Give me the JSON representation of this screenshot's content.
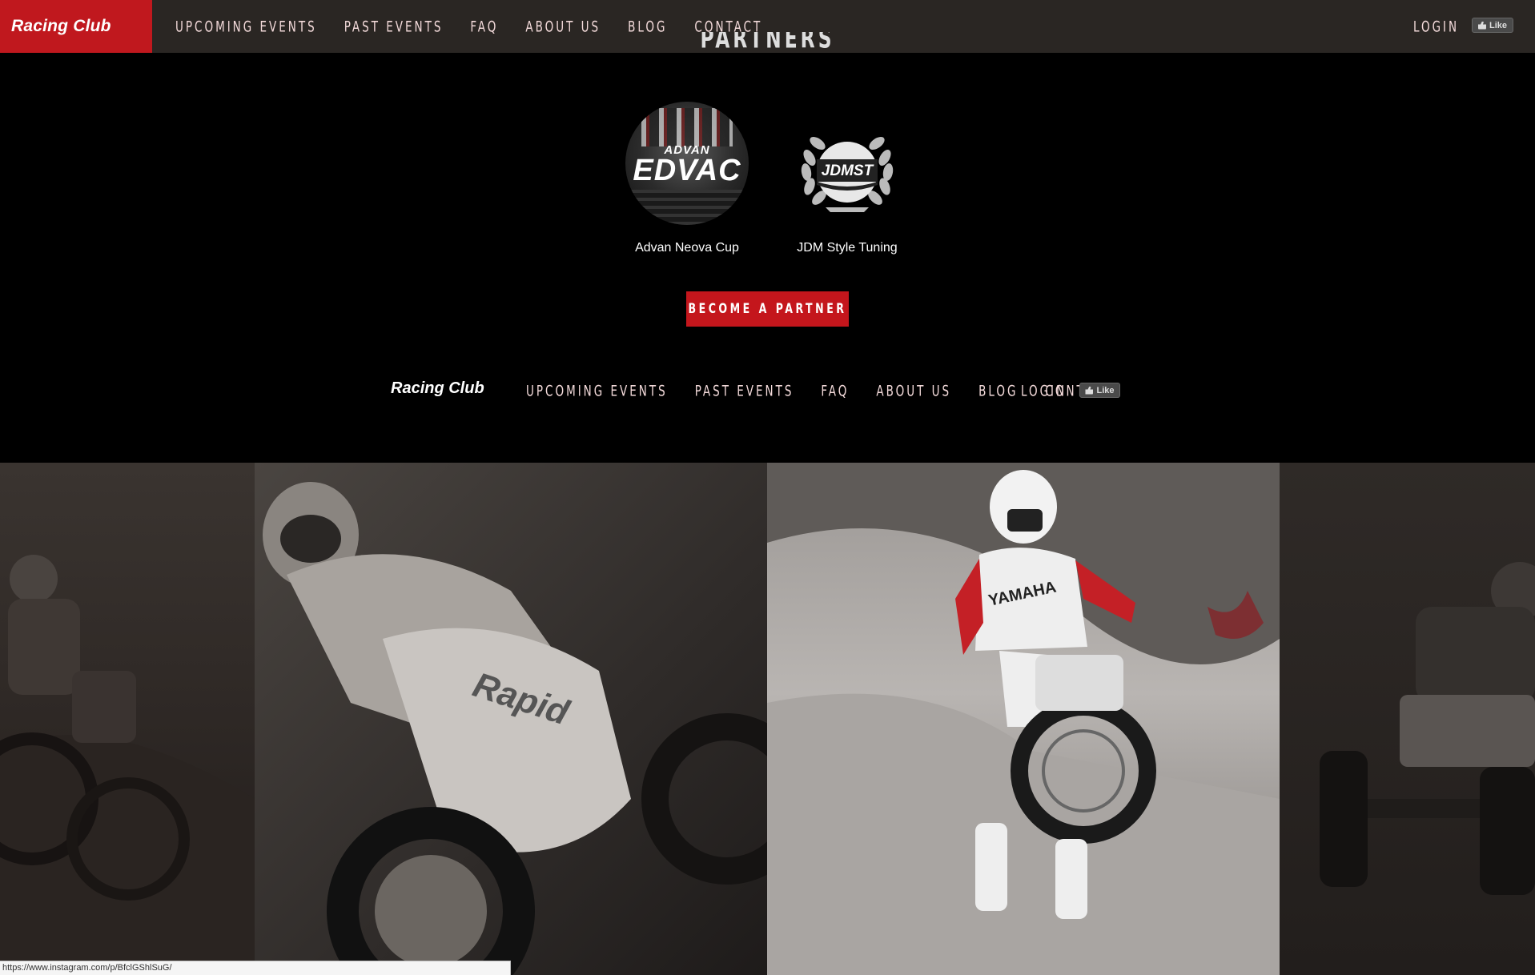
{
  "header": {
    "brand": "Racing Club",
    "nav": [
      {
        "label": "Upcoming Events"
      },
      {
        "label": "Past Events"
      },
      {
        "label": "FAQ"
      },
      {
        "label": "About Us"
      },
      {
        "label": "Blog"
      },
      {
        "label": "Contact"
      }
    ],
    "login_label": "LOGIN",
    "like_label": "Like"
  },
  "partners": {
    "title": "PARTNERS",
    "items": [
      {
        "name": "Advan Neova Cup",
        "logo_text_top": "ADVAN",
        "logo_text_main": "EDVAC"
      },
      {
        "name": "JDM Style Tuning",
        "logo_text": "JDMST"
      }
    ],
    "cta_label": "BECOME A PARTNER"
  },
  "footer": {
    "brand": "Racing Club",
    "nav": [
      {
        "label": "UPCOMING EVENTS"
      },
      {
        "label": "PAST EVENTS"
      },
      {
        "label": "FAQ"
      },
      {
        "label": "ABOUT US"
      },
      {
        "label": "BLOG"
      },
      {
        "label": "CONTACT"
      }
    ],
    "login_label": "LOGIN",
    "like_label": "Like"
  },
  "gallery": {
    "tiles": [
      {
        "subject": "motocross-riders"
      },
      {
        "subject": "superbike-rider",
        "bike_text": "Rapid"
      },
      {
        "subject": "dirt-bike-jump",
        "bike_text": "YAMAHA"
      },
      {
        "subject": "quad-atv"
      }
    ]
  },
  "status_bar": {
    "url": "https://www.instagram.com/p/BfclGShlSuG/"
  },
  "colors": {
    "brand_red": "#c0181e",
    "header_bg": "#2a2623",
    "page_bg": "#000000",
    "nav_text": "#f3dada"
  }
}
